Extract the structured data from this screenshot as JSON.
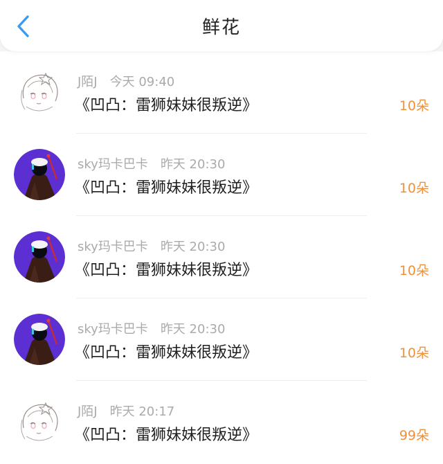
{
  "header": {
    "title": "鲜花",
    "back_icon": "chevron-left-icon",
    "accent": "#3a9cf0"
  },
  "colors": {
    "count": "#f0913a",
    "meta": "#a9aaad"
  },
  "records": [
    {
      "user": "J陌J",
      "time": "今天 09:40",
      "book": "《凹凸：雷狮妹妹很叛逆》",
      "count": "10朵",
      "avatar": "anime-sketch-avatar"
    },
    {
      "user": "sky玛卡巴卡",
      "time": "昨天 20:30",
      "book": "《凹凸：雷狮妹妹很叛逆》",
      "count": "10朵",
      "avatar": "purple-cloak-avatar"
    },
    {
      "user": "sky玛卡巴卡",
      "time": "昨天 20:30",
      "book": "《凹凸：雷狮妹妹很叛逆》",
      "count": "10朵",
      "avatar": "purple-cloak-avatar"
    },
    {
      "user": "sky玛卡巴卡",
      "time": "昨天 20:30",
      "book": "《凹凸：雷狮妹妹很叛逆》",
      "count": "10朵",
      "avatar": "purple-cloak-avatar"
    },
    {
      "user": "J陌J",
      "time": "昨天 20:17",
      "book": "《凹凸：雷狮妹妹很叛逆》",
      "count": "99朵",
      "avatar": "anime-sketch-avatar"
    }
  ]
}
